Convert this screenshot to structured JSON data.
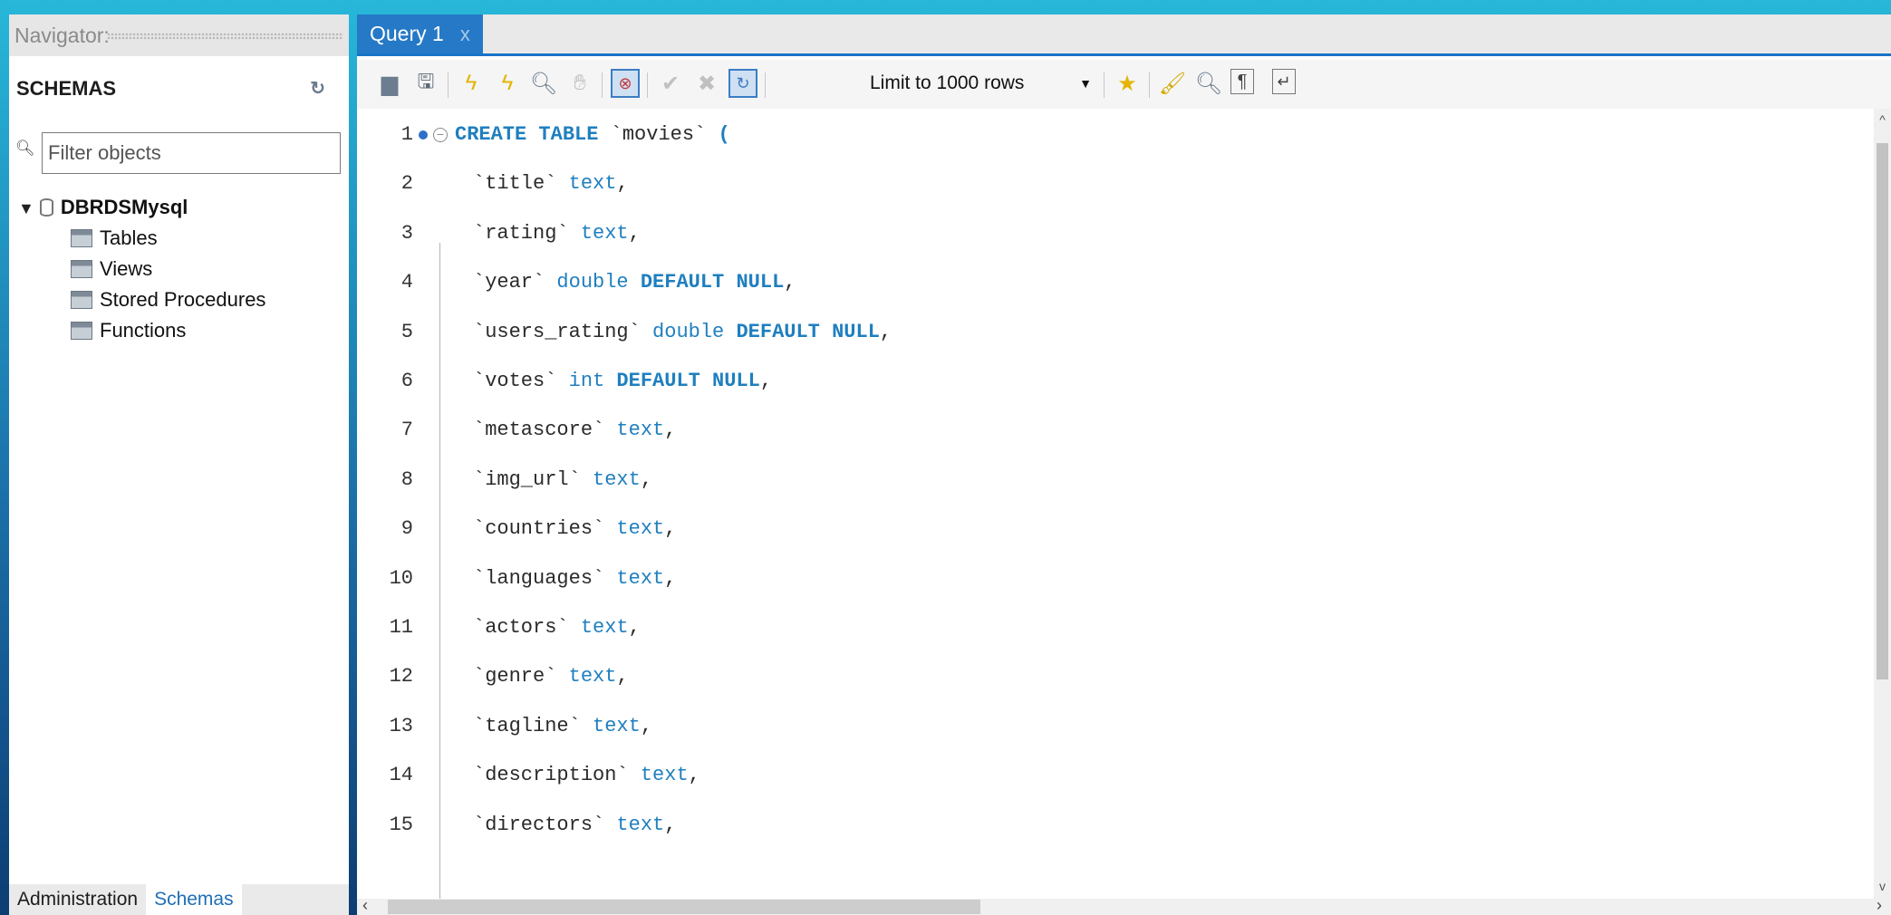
{
  "navigator": {
    "title": "Navigator:",
    "schemas_header": "SCHEMAS",
    "filter_placeholder": "Filter objects",
    "database": "DBRDSMysql",
    "tree_items": [
      "Tables",
      "Views",
      "Stored Procedures",
      "Functions"
    ],
    "tabs": {
      "administration": "Administration",
      "schemas": "Schemas"
    }
  },
  "editor": {
    "tab_title": "Query 1",
    "tab_close": "x",
    "limit_label": "Limit to 1000 rows",
    "code_lines": [
      [
        [
          "kw",
          "CREATE TABLE "
        ],
        [
          "ident",
          "`movies`"
        ],
        [
          "kw",
          " ("
        ]
      ],
      [
        [
          "ident",
          "`title`"
        ],
        [
          "type",
          " text"
        ],
        [
          "ident",
          ","
        ]
      ],
      [
        [
          "ident",
          "`rating`"
        ],
        [
          "type",
          " text"
        ],
        [
          "ident",
          ","
        ]
      ],
      [
        [
          "ident",
          "`year`"
        ],
        [
          "type",
          " double"
        ],
        [
          "kw",
          " DEFAULT NULL"
        ],
        [
          "ident",
          ","
        ]
      ],
      [
        [
          "ident",
          "`users_rating`"
        ],
        [
          "type",
          " double"
        ],
        [
          "kw",
          " DEFAULT NULL"
        ],
        [
          "ident",
          ","
        ]
      ],
      [
        [
          "ident",
          "`votes`"
        ],
        [
          "type",
          " int"
        ],
        [
          "kw",
          " DEFAULT NULL"
        ],
        [
          "ident",
          ","
        ]
      ],
      [
        [
          "ident",
          "`metascore`"
        ],
        [
          "type",
          " text"
        ],
        [
          "ident",
          ","
        ]
      ],
      [
        [
          "ident",
          "`img_url`"
        ],
        [
          "type",
          " text"
        ],
        [
          "ident",
          ","
        ]
      ],
      [
        [
          "ident",
          "`countries`"
        ],
        [
          "type",
          " text"
        ],
        [
          "ident",
          ","
        ]
      ],
      [
        [
          "ident",
          "`languages`"
        ],
        [
          "type",
          " text"
        ],
        [
          "ident",
          ","
        ]
      ],
      [
        [
          "ident",
          "`actors`"
        ],
        [
          "type",
          " text"
        ],
        [
          "ident",
          ","
        ]
      ],
      [
        [
          "ident",
          "`genre`"
        ],
        [
          "type",
          " text"
        ],
        [
          "ident",
          ","
        ]
      ],
      [
        [
          "ident",
          "`tagline`"
        ],
        [
          "type",
          " text"
        ],
        [
          "ident",
          ","
        ]
      ],
      [
        [
          "ident",
          "`description`"
        ],
        [
          "type",
          " text"
        ],
        [
          "ident",
          ","
        ]
      ],
      [
        [
          "ident",
          "`directors`"
        ],
        [
          "type",
          " text"
        ],
        [
          "ident",
          ","
        ]
      ]
    ]
  },
  "colors": {
    "accent": "#2579c7",
    "keyword": "#1f7fbf",
    "background": "#1b6fa8"
  },
  "icons": [
    "open-file-icon",
    "save-icon",
    "execute-icon",
    "execute-current-icon",
    "explain-icon",
    "stop-icon",
    "toggle-output-icon",
    "commit-icon",
    "rollback-icon",
    "autocommit-icon",
    "add-snippet-icon",
    "beautify-icon",
    "find-icon",
    "invisible-chars-icon",
    "word-wrap-icon"
  ]
}
